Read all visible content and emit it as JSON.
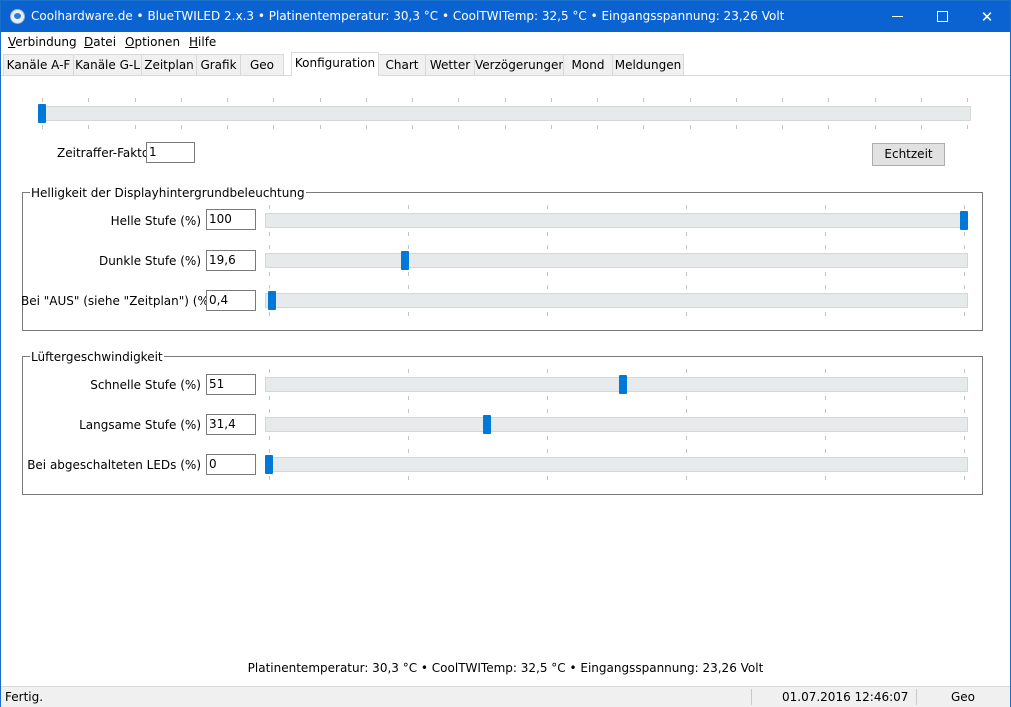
{
  "window": {
    "title": "Coolhardware.de • BlueTWILED 2.x.3 • Platinentemperatur: 30,3 °C • CoolTWITemp: 32,5 °C • Eingangsspannung: 23,26 Volt",
    "minimize_icon": "minimize-icon",
    "maximize_icon": "maximize-icon",
    "close_glyph": "✕"
  },
  "menu": {
    "items": [
      {
        "underline": "V",
        "rest": "erbindung"
      },
      {
        "underline": "D",
        "rest": "atei"
      },
      {
        "underline": "O",
        "rest": "ptionen"
      },
      {
        "underline": "H",
        "rest": "ilfe"
      }
    ]
  },
  "tabs": [
    {
      "label": "Kanäle A-F"
    },
    {
      "label": "Kanäle G-L"
    },
    {
      "label": "Zeitplan"
    },
    {
      "label": "Grafik"
    },
    {
      "label": "Geo"
    },
    {
      "label": "Konfiguration",
      "active": true
    },
    {
      "label": "Chart"
    },
    {
      "label": "Wetter"
    },
    {
      "label": "Verzögerungen"
    },
    {
      "label": "Mond"
    },
    {
      "label": "Meldungen"
    }
  ],
  "timelapse": {
    "label": "Zeitraffer-Faktor",
    "value": "1",
    "slider_position": 0.0,
    "realtime_button": "Echtzeit"
  },
  "display_group": {
    "title": "Helligkeit der Displayhintergrundbeleuchtung",
    "rows": [
      {
        "label": "Helle Stufe (%)",
        "value": "100",
        "level": 1.0
      },
      {
        "label": "Dunkle Stufe (%)",
        "value": "19,6",
        "level": 0.196
      },
      {
        "label": "Bei \"AUS\" (siehe \"Zeitplan\") (%)",
        "value": "0,4",
        "level": 0.004
      }
    ]
  },
  "fan_group": {
    "title": "Lüftergeschwindigkeit",
    "rows": [
      {
        "label": "Schnelle Stufe (%)",
        "value": "51",
        "level": 0.51
      },
      {
        "label": "Langsame Stufe (%)",
        "value": "31,4",
        "level": 0.314
      },
      {
        "label": "Bei abgeschalteten LEDs (%)",
        "value": "0",
        "level": 0.0
      }
    ]
  },
  "info_line": "Platinentemperatur: 30,3 °C • CoolTWITemp: 32,5 °C • Eingangsspannung: 23,26 Volt",
  "statusbar": {
    "status": "Fertig.",
    "datetime": "01.07.2016 12:46:07",
    "mode": "Geo"
  },
  "colors": {
    "titlebar": "#0a63d0",
    "slider_thumb": "#0078d7"
  }
}
